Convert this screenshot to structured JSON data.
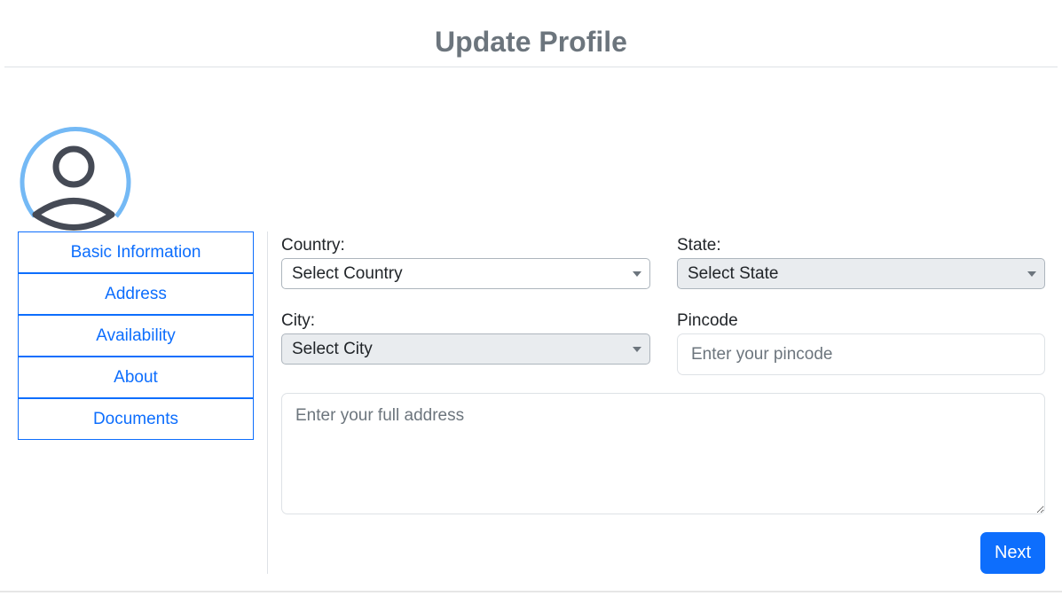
{
  "header": {
    "title": "Update Profile"
  },
  "avatar": {
    "icon": "user-avatar-icon",
    "ring_color": "#74b9f5"
  },
  "sidebar": {
    "items": [
      {
        "label": "Basic Information"
      },
      {
        "label": "Address"
      },
      {
        "label": "Availability"
      },
      {
        "label": "About"
      },
      {
        "label": "Documents"
      }
    ]
  },
  "form": {
    "country": {
      "label": "Country:",
      "value": "Select Country"
    },
    "state": {
      "label": "State:",
      "value": "Select State"
    },
    "city": {
      "label": "City:",
      "value": "Select City"
    },
    "pincode": {
      "label": "Pincode",
      "placeholder": "Enter your pincode"
    },
    "address": {
      "placeholder": "Enter your full address"
    },
    "next_label": "Next"
  },
  "colors": {
    "accent": "#0d6efd",
    "title": "#6c757d"
  }
}
